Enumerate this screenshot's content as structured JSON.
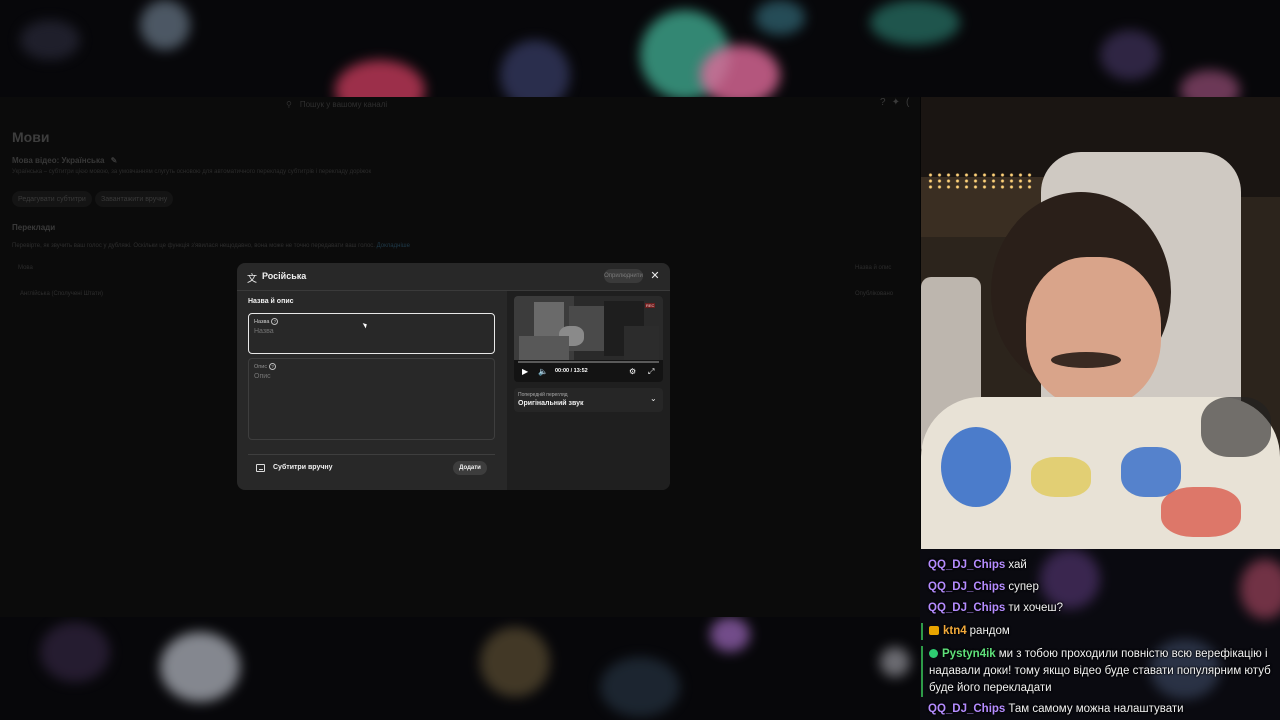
{
  "studio": {
    "search_placeholder": "Пошук у вашому каналі",
    "page_title": "Мови",
    "video_language_label": "Мова відео: Українська",
    "video_language_note": "Українська – субтитри цією мовою, за умовчанням слугуть основою для автоматичного перекладу субтитрів і перекладу доріжок",
    "edit_subtitles_button": "Редагувати субтитри",
    "upload_manually_button": "Завантажити вручну",
    "translations_heading": "Переклади",
    "translations_note": "Перевірте, як звучить ваш голос у дубляжі. Оскільки це функція з'явилася нещодавно, вона може не точно передавати ваш голос.",
    "translations_link": "Докладніше",
    "col_language": "Мова",
    "col_title_desc": "Назва й опис",
    "row_language": "Англійська (Сполучені Штати)",
    "row_status": "Опубліковано"
  },
  "dialog": {
    "title": "Російська",
    "publish_label": "Оприлюднити",
    "section_title": "Назва й опис",
    "name_label": "Назва",
    "name_placeholder": "Назва",
    "description_label": "Опис",
    "description_placeholder": "Опис",
    "subtitles_label": "Субтитри вручну",
    "add_label": "Додати",
    "player": {
      "time": "00:00 / 13:52",
      "progress": 0,
      "rec_badge": "REC"
    },
    "audio_select": {
      "label": "Попередній перегляд",
      "value": "Оригінальний звук"
    }
  },
  "chat": {
    "messages": [
      {
        "user": "QQ_DJ_Chips",
        "text": "хай",
        "color": "#b58cff"
      },
      {
        "user": "QQ_DJ_Chips",
        "text": "супер",
        "color": "#b58cff"
      },
      {
        "user": "QQ_DJ_Chips",
        "text": "ти хочеш?",
        "color": "#b58cff"
      },
      {
        "user": "ktn4",
        "text": "рандом",
        "color": "#f2a93b",
        "badge": "crown"
      },
      {
        "user": "Pystyn4ik",
        "text": "ми з тобою проходили повністю всю верефікацію і надавали доки! тому якщо відео буде ставати популярним ютуб буде його перекладати",
        "color": "#5fe07a",
        "badge": "check"
      },
      {
        "user": "QQ_DJ_Chips",
        "text": "Там самому можна налаштувати",
        "color": "#b58cff"
      }
    ]
  },
  "colors": {
    "dialog_bg": "#282828",
    "accent_purple": "#b58cff",
    "accent_green": "#2e9b48"
  }
}
